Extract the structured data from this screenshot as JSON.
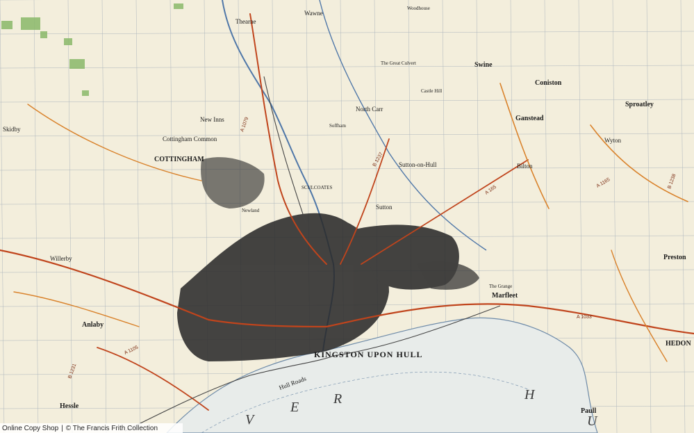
{
  "map": {
    "colors": {
      "paper": "#f3eedc",
      "urban": "#2b2b2b",
      "road_a": "#c0441c",
      "road_b": "#d9822b",
      "water": "#8fb0cf",
      "river_fill": "#dfe7ec",
      "grid": "#7d8fa8",
      "woodland": "#8ab86a"
    },
    "places": {
      "wawne": "Wawne",
      "thearne": "Thearne",
      "swine": "Swine",
      "coniston": "Coniston",
      "sproatley": "Sproatley",
      "skidby": "Skidby",
      "cottingham": "COTTINGHAM",
      "cottingham_common": "Cottingham Common",
      "ganstead": "Ganstead",
      "wyton": "Wyton",
      "bilton": "Bilton",
      "sutton_on_hull": "Sutton-on-Hull",
      "sutton": "Sutton",
      "preston": "Preston",
      "marfleet": "Marfleet",
      "anlaby": "Anlaby",
      "hessle": "Hessle",
      "willerby": "Willerby",
      "kingston": "KINGSTON UPON HULL",
      "paull": "Paull",
      "hedon": "HEDON",
      "new_inns": "New Inns",
      "north_carr": "North Carr",
      "soffham": "Soffham",
      "newland": "Newland",
      "sculcoates": "SCULCOATES",
      "hull_roads": "Hull Roads",
      "castle_hill": "Castle Hill",
      "the_great_culvert": "The Great Culvert",
      "woodhouse": "Woodhouse",
      "the_grange": "The Grange"
    },
    "river_letters": [
      "V",
      "E",
      "R",
      "H",
      "U"
    ],
    "road_labels": {
      "a1079": "A 1079",
      "a1033": "A 1033",
      "a165": "A 165",
      "b1238": "B 1238",
      "b1237": "B 1237",
      "a1105": "A 1105",
      "a1165": "A 1165",
      "b1231": "B 1231"
    }
  },
  "footer": {
    "left": "Online Copy Shop",
    "right": "© The Francis Frith Collection"
  }
}
